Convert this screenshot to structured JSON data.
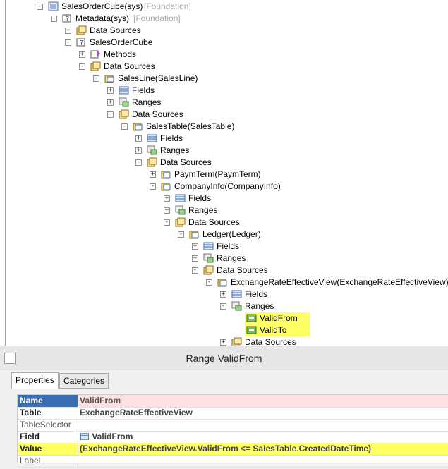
{
  "tree": [
    {
      "id": "n0",
      "label": "SalesOrderCube(sys)",
      "suffix": "[Foundation]",
      "exp": "-",
      "icon": "cube-icon"
    },
    {
      "id": "n1",
      "label": "Metadata(sys)",
      "suffix": "[Foundation]",
      "exp": "-",
      "icon": "metadata-icon"
    },
    {
      "id": "n2",
      "label": "Data Sources",
      "exp": "+",
      "icon": "datasources-icon"
    },
    {
      "id": "n3",
      "label": "SalesOrderCube",
      "exp": "-",
      "icon": "query-icon"
    },
    {
      "id": "n4",
      "label": "Methods",
      "exp": "+",
      "icon": "methods-icon"
    },
    {
      "id": "n5",
      "label": "Data Sources",
      "exp": "-",
      "icon": "datasources-icon"
    },
    {
      "id": "n6",
      "label": "SalesLine(SalesLine)",
      "exp": "-",
      "icon": "datasource-icon"
    },
    {
      "id": "n7",
      "label": "Fields",
      "exp": "+",
      "icon": "fields-icon"
    },
    {
      "id": "n8",
      "label": "Ranges",
      "exp": "+",
      "icon": "ranges-icon"
    },
    {
      "id": "n9",
      "label": "Data Sources",
      "exp": "-",
      "icon": "datasources-icon"
    },
    {
      "id": "n10",
      "label": "SalesTable(SalesTable)",
      "exp": "-",
      "icon": "datasource-icon"
    },
    {
      "id": "n11",
      "label": "Fields",
      "exp": "+",
      "icon": "fields-icon"
    },
    {
      "id": "n12",
      "label": "Ranges",
      "exp": "+",
      "icon": "ranges-icon"
    },
    {
      "id": "n13",
      "label": "Data Sources",
      "exp": "-",
      "icon": "datasources-icon"
    },
    {
      "id": "n14",
      "label": "PaymTerm(PaymTerm)",
      "exp": "+",
      "icon": "datasource-icon"
    },
    {
      "id": "n15",
      "label": "CompanyInfo(CompanyInfo)",
      "exp": "-",
      "icon": "datasource-icon"
    },
    {
      "id": "n16",
      "label": "Fields",
      "exp": "+",
      "icon": "fields-icon"
    },
    {
      "id": "n17",
      "label": "Ranges",
      "exp": "+",
      "icon": "ranges-icon"
    },
    {
      "id": "n18",
      "label": "Data Sources",
      "exp": "-",
      "icon": "datasources-icon"
    },
    {
      "id": "n19",
      "label": "Ledger(Ledger)",
      "exp": "-",
      "icon": "datasource-icon"
    },
    {
      "id": "n20",
      "label": "Fields",
      "exp": "+",
      "icon": "fields-icon"
    },
    {
      "id": "n21",
      "label": "Ranges",
      "exp": "+",
      "icon": "ranges-icon"
    },
    {
      "id": "n22",
      "label": "Data Sources",
      "exp": "-",
      "icon": "datasources-icon"
    },
    {
      "id": "n23",
      "label": "ExchangeRateEffectiveView(ExchangeRateEffectiveView)",
      "exp": "-",
      "icon": "datasource-icon"
    },
    {
      "id": "n24",
      "label": "Fields",
      "exp": "+",
      "icon": "fields-icon"
    },
    {
      "id": "n25",
      "label": "Ranges",
      "exp": "-",
      "icon": "ranges-icon"
    },
    {
      "id": "n26",
      "label": "ValidFrom",
      "exp": "",
      "icon": "range-item-icon",
      "highlight": true
    },
    {
      "id": "n27",
      "label": "ValidTo",
      "exp": "",
      "icon": "range-item-icon",
      "highlight": true
    },
    {
      "id": "n28",
      "label": "Data Sources",
      "exp": "+",
      "icon": "datasources-icon"
    }
  ],
  "props": {
    "title": "Range ValidFrom",
    "tabs": [
      "Properties",
      "Categories"
    ],
    "rows": [
      {
        "key": "Name",
        "value": "ValidFrom"
      },
      {
        "key": "Table",
        "value": "ExchangeRateEffectiveView"
      },
      {
        "key": "TableSelector",
        "value": ""
      },
      {
        "key": "Field",
        "value": "ValidFrom"
      },
      {
        "key": "Value",
        "value": "(ExchangeRateEffectiveView.ValidFrom <= SalesTable.CreatedDateTime)"
      },
      {
        "key": "Label",
        "value": ""
      }
    ]
  },
  "colors": {
    "highlight": "#ffff66",
    "selection": "#3a6fb5",
    "name_value_bg": "#ffe0e0"
  }
}
